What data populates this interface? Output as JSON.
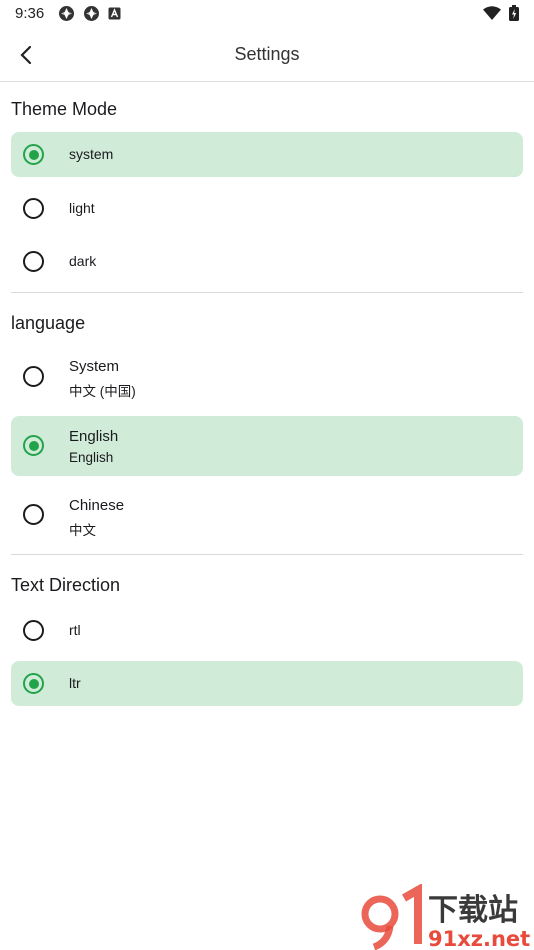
{
  "status_bar": {
    "time": "9:36"
  },
  "app_bar": {
    "title": "Settings"
  },
  "theme": {
    "title": "Theme Mode",
    "options": [
      {
        "label": "system",
        "selected": true
      },
      {
        "label": "light",
        "selected": false
      },
      {
        "label": "dark",
        "selected": false
      }
    ]
  },
  "language": {
    "title": "language",
    "options": [
      {
        "title": "System",
        "subtitle": "中文 (中国)",
        "selected": false
      },
      {
        "title": "English",
        "subtitle": "English",
        "selected": true
      },
      {
        "title": "Chinese",
        "subtitle": "中文",
        "selected": false
      }
    ]
  },
  "direction": {
    "title": "Text Direction",
    "options": [
      {
        "label": "rtl",
        "selected": false
      },
      {
        "label": "ltr",
        "selected": true
      }
    ]
  },
  "watermark": {
    "text1": "下载站",
    "text2": "91xz.net"
  },
  "colors": {
    "accent": "#22a34a",
    "selected_bg": "#d0ebd8"
  }
}
